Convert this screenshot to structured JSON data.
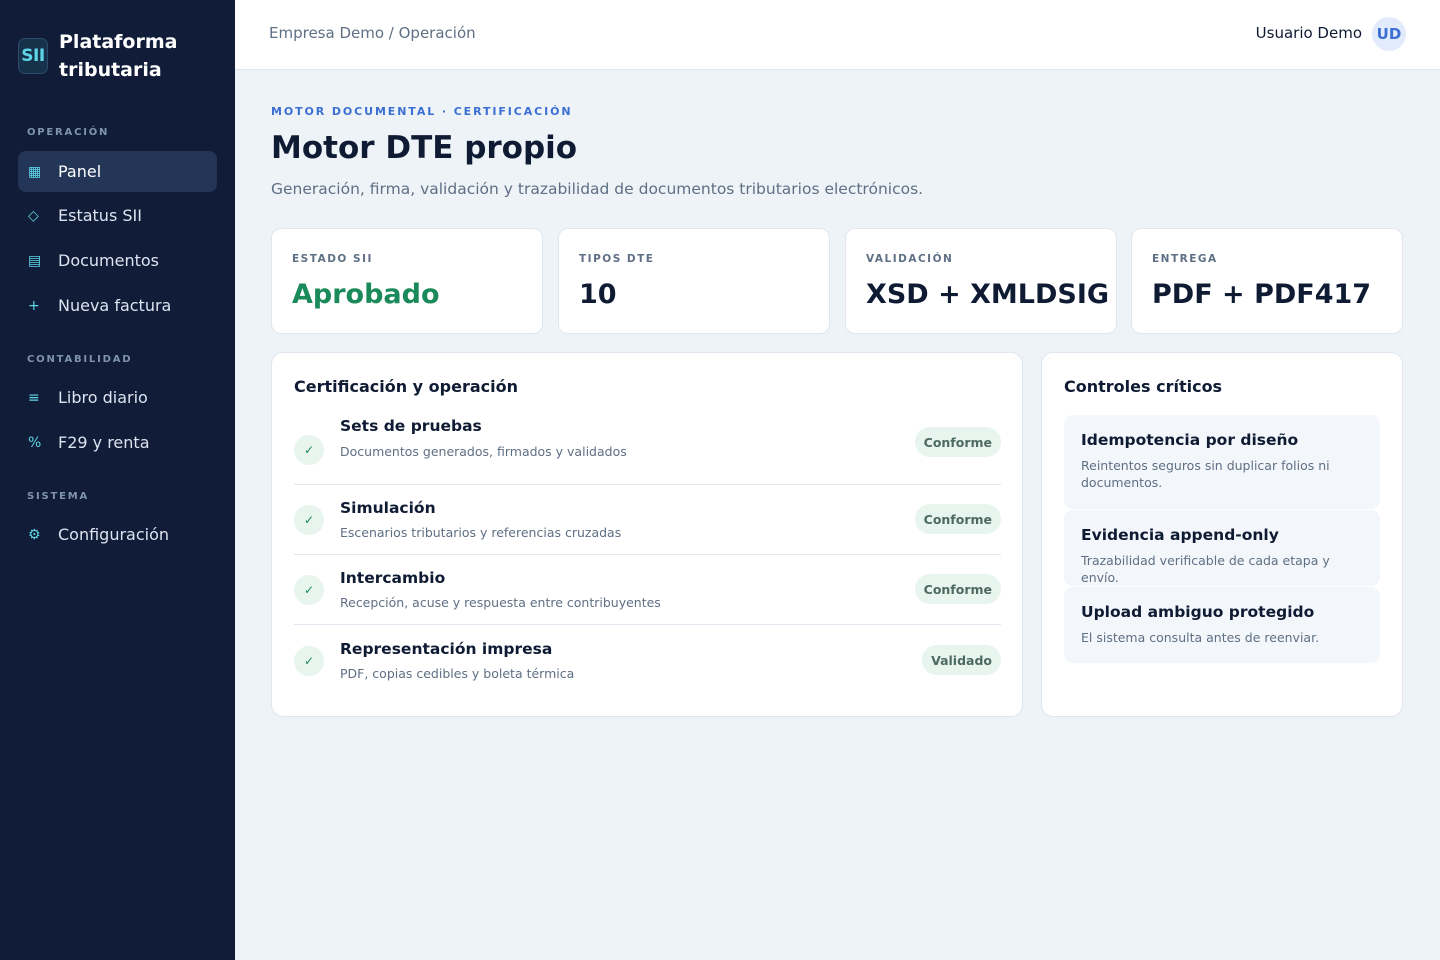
{
  "brand": {
    "logo": "SII",
    "name": "Plataforma tributaria"
  },
  "nav": {
    "sections": [
      {
        "title": "OPERACIÓN"
      },
      {
        "title": "CONTABILIDAD"
      },
      {
        "title": "SISTEMA"
      }
    ],
    "items": [
      {
        "label": "Panel",
        "icon": "▦",
        "icon_name": "grid-icon",
        "active": true
      },
      {
        "label": "Estatus SII",
        "icon": "◇",
        "icon_name": "diamond-icon"
      },
      {
        "label": "Documentos",
        "icon": "▤",
        "icon_name": "document-icon"
      },
      {
        "label": "Nueva factura",
        "icon": "+",
        "icon_name": "plus-icon"
      },
      {
        "label": "Libro diario",
        "icon": "≡",
        "icon_name": "list-icon"
      },
      {
        "label": "F29 y renta",
        "icon": "%",
        "icon_name": "percent-icon"
      },
      {
        "label": "Configuración",
        "icon": "⚙",
        "icon_name": "gear-icon"
      }
    ]
  },
  "header": {
    "breadcrumb": "Empresa Demo / Operación",
    "user_name": "Usuario Demo",
    "avatar": "UD"
  },
  "main": {
    "eyebrow": "MOTOR DOCUMENTAL · CERTIFICACIÓN",
    "title": "Motor DTE propio",
    "subtitle": "Generación, firma, validación y trazabilidad de documentos tributarios electrónicos."
  },
  "stats": [
    {
      "label": "ESTADO SII",
      "value": "Aprobado"
    },
    {
      "label": "TIPOS DTE",
      "value": "10"
    },
    {
      "label": "VALIDACIÓN",
      "value": "XSD + XMLDSIG"
    },
    {
      "label": "ENTREGA",
      "value": "PDF + PDF417"
    }
  ],
  "certification": {
    "title": "Certificación y operación",
    "check_icon": "✓",
    "rows": [
      {
        "title": "Sets de pruebas",
        "desc": "Documentos generados, firmados y validados",
        "badge": "Conforme"
      },
      {
        "title": "Simulación",
        "desc": "Escenarios tributarios y referencias cruzadas",
        "badge": "Conforme"
      },
      {
        "title": "Intercambio",
        "desc": "Recepción, acuse y respuesta entre contribuyentes",
        "badge": "Conforme"
      },
      {
        "title": "Representación impresa",
        "desc": "PDF, copias cedibles y boleta térmica",
        "badge": "Validado"
      }
    ]
  },
  "controls": {
    "title": "Controles críticos",
    "items": [
      {
        "title": "Idempotencia por diseño",
        "desc": "Reintentos seguros sin duplicar folios ni documentos."
      },
      {
        "title": "Evidencia append-only",
        "desc": "Trazabilidad verificable de cada etapa y envío."
      },
      {
        "title": "Upload ambiguo protegido",
        "desc": "El sistema consulta antes de reenviar."
      }
    ]
  },
  "colors": {
    "sidebar_bg": "#111d38",
    "accent": "#3b6fd3",
    "success": "#1a8a5a",
    "icon_accent": "#5fd6e8"
  }
}
